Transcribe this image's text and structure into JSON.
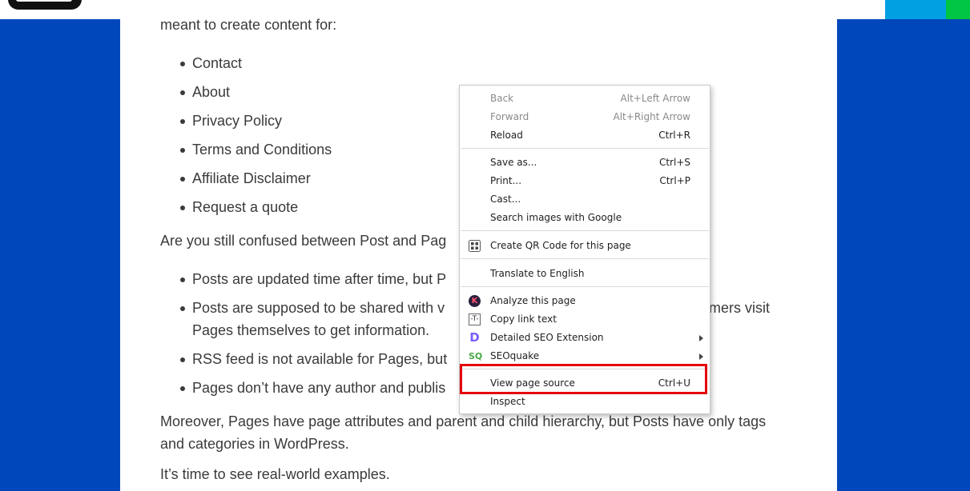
{
  "page": {
    "intro": "meant to create content for:",
    "list1": [
      "Contact",
      "About",
      "Privacy Policy",
      "Terms and Conditions",
      "Affiliate Disclaimer",
      "Request a quote"
    ],
    "question": "Are you still confused between Post and Pag",
    "list2": [
      "Posts are updated time after time, but P",
      "Posts are supposed to be shared with v",
      "mers visit",
      "Pages themselves to get information.",
      "RSS feed is not available for Pages, but",
      "Pages don’t have any author and publis"
    ],
    "para1_line1": "Moreover, Pages have page attributes and parent and child hierarchy, but Posts have only tags",
    "para1_line2": "and categories in WordPress.",
    "para2": "It’s time to see real-world examples."
  },
  "context_menu": {
    "items": [
      {
        "label": "Back",
        "shortcut": "Alt+Left Arrow",
        "disabled": true
      },
      {
        "label": "Forward",
        "shortcut": "Alt+Right Arrow",
        "disabled": true
      },
      {
        "label": "Reload",
        "shortcut": "Ctrl+R"
      },
      {
        "label": "Save as...",
        "shortcut": "Ctrl+S"
      },
      {
        "label": "Print...",
        "shortcut": "Ctrl+P"
      },
      {
        "label": "Cast..."
      },
      {
        "label": "Search images with Google"
      },
      {
        "label": "Create QR Code for this page",
        "icon": "qr-code-icon"
      },
      {
        "label": "Translate to English"
      },
      {
        "label": "Analyze this page",
        "icon": "k-extension-icon",
        "icon_text": "K"
      },
      {
        "label": "Copy link text",
        "icon": "text-extension-icon",
        "icon_text": "-T-"
      },
      {
        "label": "Detailed SEO Extension",
        "icon": "detailed-seo-icon",
        "icon_text": "D",
        "submenu": true
      },
      {
        "label": "SEOquake",
        "icon": "seoquake-icon",
        "icon_text": "SQ",
        "submenu": true
      },
      {
        "label": "View page source",
        "shortcut": "Ctrl+U",
        "highlighted": true
      },
      {
        "label": "Inspect"
      }
    ]
  },
  "colors": {
    "background_blue": "#0047bb",
    "highlight_red": "#e3060b",
    "accent_cyan": "#00a0e3",
    "accent_green": "#00c443"
  }
}
